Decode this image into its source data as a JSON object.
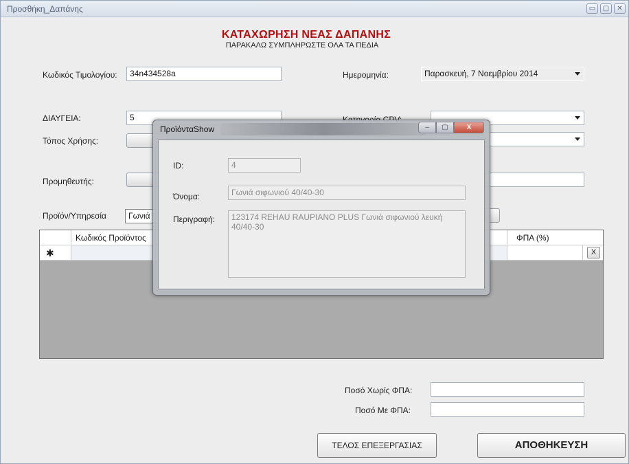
{
  "window": {
    "title": "Προσθήκη_Δαπάνης",
    "controls": {
      "minimize": "▭",
      "maximize": "▢",
      "close": "✕"
    }
  },
  "header": {
    "title": "ΚΑΤΑΧΩΡΗΣΗ ΝΕΑΣ ΔΑΠΑΝΗΣ",
    "subtitle": "ΠΑΡΑΚΑΛΩ ΣΥΜΠΛΗΡΩΣΤΕ ΟΛΑ ΤΑ ΠΕΔΙΑ"
  },
  "form": {
    "invoice_code_label": "Κωδικός Τιμολογίου:",
    "invoice_code_value": "34n434528a",
    "date_label": "Ημερομηνία:",
    "date_value": "Παρασκευή,  7  Νοεμβρίου  2014",
    "diavgeia_label": "ΔΙΑΥΓΕΙΑ:",
    "diavgeia_value": "5",
    "cpv_label": "Κατηγορία CPV:",
    "place_label": "Τόπος Χρήσης:",
    "supplier_label": "Προμηθευτής:",
    "product_label": "Προϊόν/Υπηρεσία",
    "product_value": "Γωνιά"
  },
  "grid": {
    "columns": [
      "Κωδικός Προϊόντος",
      "ΦΠΑ (%)"
    ],
    "new_row_marker": "✱",
    "delete_label": "X"
  },
  "totals": {
    "without_vat_label": "Ποσό Χωρίς ΦΠΑ:",
    "with_vat_label": "Ποσό Με ΦΠΑ:"
  },
  "buttons": {
    "finish": "ΤΕΛΟΣ ΕΠΕΞΕΡΓΑΣΙΑΣ",
    "save": "ΑΠΟΘΗΚΕΥΣΗ"
  },
  "dialog": {
    "title": "ΠροϊόνταShow",
    "close": "X",
    "id_label": "ID:",
    "id_value": "4",
    "name_label": "Όνομα:",
    "name_value": "Γωνιά σιφωνιού 40/40-30",
    "desc_label": "Περιγραφή:",
    "desc_value": "123174 REHAU RAUPIANO PLUS Γωνιά σιφωνιού λευκή 40/40-30"
  },
  "colors": {
    "title_red": "#b01010",
    "window_bg": "#ededed",
    "grid_bg": "#ababab",
    "dialog_frame": "#b6b9be"
  }
}
